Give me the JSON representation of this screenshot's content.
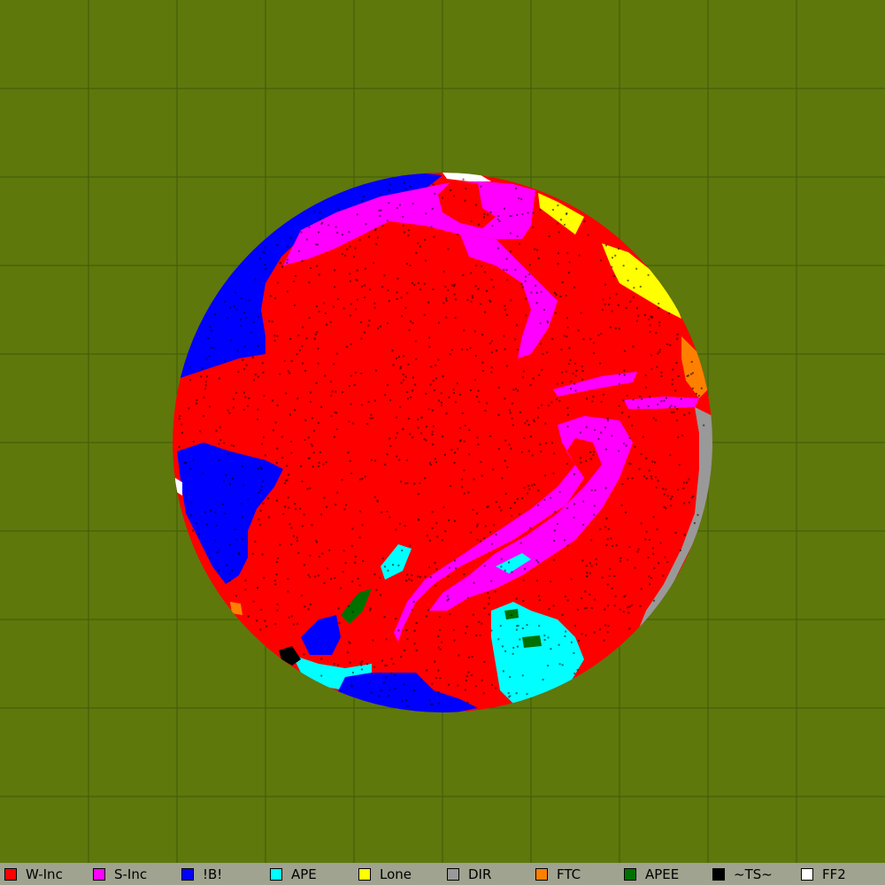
{
  "colors": {
    "background": "#5e780c",
    "grid": "#3e5a08",
    "legend_bar": "#9fa38f"
  },
  "legend": {
    "items": [
      {
        "label": "W-Inc",
        "color": "#ff0000"
      },
      {
        "label": "S-Inc",
        "color": "#ff00ff"
      },
      {
        "label": "!B!",
        "color": "#0000ff"
      },
      {
        "label": "APE",
        "color": "#00ffff"
      },
      {
        "label": "Lone",
        "color": "#ffff00"
      },
      {
        "label": "DIR",
        "color": "#999999"
      },
      {
        "label": "FTC",
        "color": "#ff8000"
      },
      {
        "label": "APEE",
        "color": "#007000"
      },
      {
        "label": "~TS~",
        "color": "#000000"
      },
      {
        "label": "FF2",
        "color": "#ffffff"
      }
    ]
  }
}
